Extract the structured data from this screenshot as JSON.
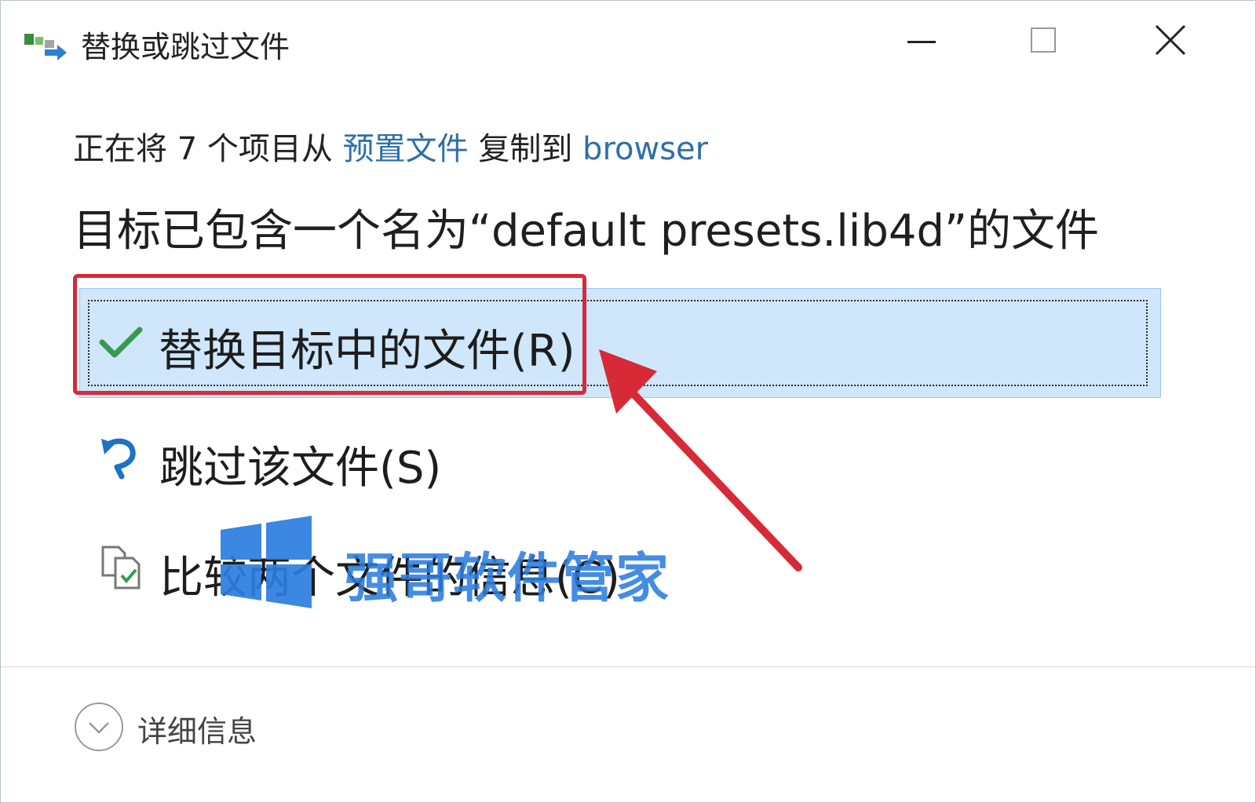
{
  "window": {
    "title": "替换或跳过文件",
    "icon": "file-move-icon",
    "controls": {
      "minimize": "minimize-icon",
      "maximize": "maximize-icon",
      "close": "close-icon"
    }
  },
  "copy_status": {
    "prefix": "正在将 7 个项目从",
    "source": "预置文件",
    "middle": "复制到",
    "destination": "browser"
  },
  "conflict_message": "目标已包含一个名为“default presets.lib4d”的文件",
  "options": [
    {
      "label": "替换目标中的文件(R)",
      "icon": "checkmark-icon",
      "selected": true
    },
    {
      "label": "跳过该文件(S)",
      "icon": "skip-arrow-icon",
      "selected": false
    },
    {
      "label": "比较两个文件的信息(C)",
      "icon": "compare-files-icon",
      "selected": false
    }
  ],
  "details": {
    "label": "详细信息",
    "icon": "chevron-down-icon"
  },
  "watermark": {
    "text": "强哥软件管家",
    "icon": "windows-logo-icon"
  },
  "colors": {
    "selection_bg": "#cfe6fb",
    "link": "#2f6fa8",
    "annotation": "#d62a36",
    "watermark": "#2b7dde"
  }
}
